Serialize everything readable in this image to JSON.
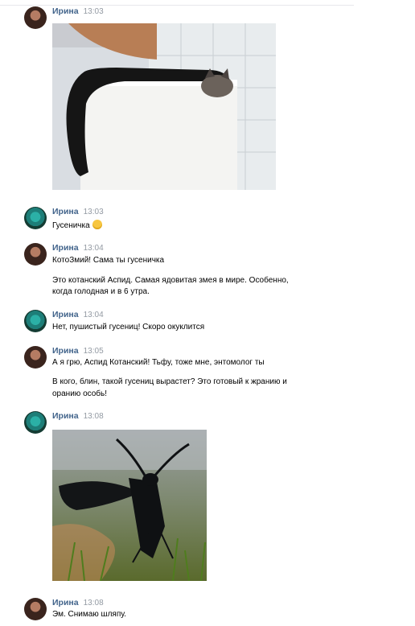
{
  "messages": [
    {
      "author": "Ирина",
      "time": "13:03",
      "lines": [],
      "attachment": "cat-on-fridge-photo"
    },
    {
      "author": "Ирина",
      "time": "13:03",
      "lines": [
        "Гусеничка"
      ],
      "emoji": "grinning-sweat-emoji"
    },
    {
      "author": "Ирина",
      "time": "13:04",
      "lines": [
        "КотоЗмий! Сама ты гусеничка",
        "Это котанский Аспид. Самая ядовитая змея в мире. Особенно,",
        "когда голодная и в 6 утра."
      ]
    },
    {
      "author": "Ирина",
      "time": "13:04",
      "lines": [
        "Нет, пушистый гусениц! Скоро окуклится"
      ]
    },
    {
      "author": "Ирина",
      "time": "13:05",
      "lines": [
        "А я грю, Аспид Котанский! Тьфу, тоже мне, энтомолог ты",
        "В кого, блин, такой гусениц вырастет? Это готовый к жранию и",
        "оранию особь!"
      ]
    },
    {
      "author": "Ирина",
      "time": "13:08",
      "lines": [],
      "attachment": "moth-photo"
    },
    {
      "author": "Ирина",
      "time": "13:08",
      "lines": [
        "Эм. Снимаю шляпу."
      ]
    }
  ]
}
